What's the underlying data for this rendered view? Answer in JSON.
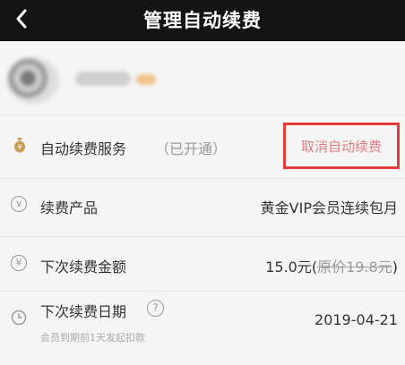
{
  "header": {
    "title": "管理自动续费"
  },
  "user": {
    "avatar": "avatar",
    "nickname": ""
  },
  "auto_renew": {
    "label": "自动续费服务",
    "status": "（已开通）",
    "cancel_label": "取消自动续费"
  },
  "product": {
    "label": "续费产品",
    "value": "黄金VIP会员连续包月"
  },
  "amount": {
    "label": "下次续费金额",
    "current": "15.0元",
    "original_prefix": "(",
    "original": "原价19.8元",
    "original_suffix": ")"
  },
  "date": {
    "label": "下次续费日期",
    "value": "2019-04-21",
    "note": "会员到期前1天发起扣款"
  },
  "colors": {
    "topbar": "#141414",
    "highlight_box": "#e53a3a",
    "cancel_text": "#e07f7f"
  },
  "icons": {
    "back": "chevron-left-icon",
    "auto_renew": "money-bag-icon",
    "product": "chevron-down-circle-icon",
    "amount": "yen-circle-icon",
    "date": "clock-icon",
    "help": "question-circle-icon"
  }
}
